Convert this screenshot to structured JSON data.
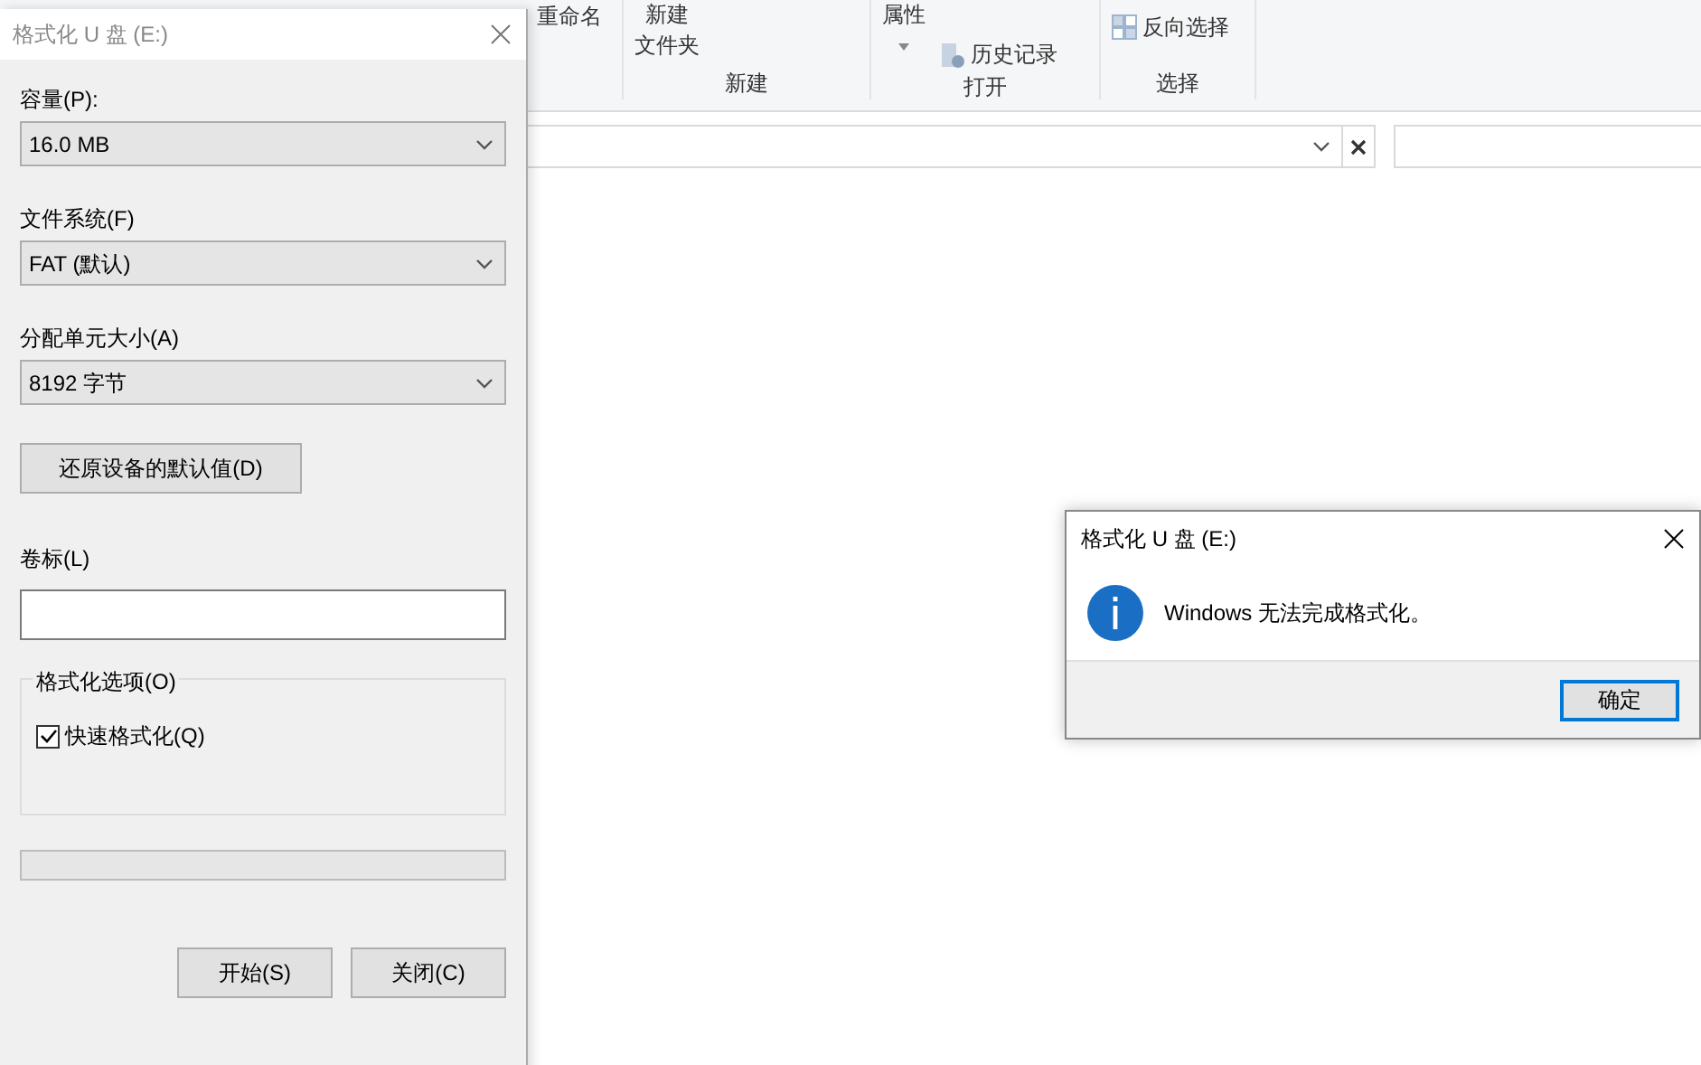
{
  "explorer": {
    "ribbon_groups": [
      {
        "items": [
          {
            "kind": "small",
            "label": "重命名"
          }
        ]
      },
      {
        "items": [
          {
            "kind": "large",
            "lines": [
              "新建",
              "文件夹"
            ]
          }
        ],
        "label": "新建"
      },
      {
        "items": [
          {
            "kind": "large",
            "lines": [
              "属性"
            ],
            "dropdown": true
          },
          {
            "kind": "small",
            "label": "历史记录"
          }
        ],
        "label": "打开"
      },
      {
        "items": [
          {
            "kind": "small",
            "label": "反向选择"
          }
        ],
        "label": "选择"
      }
    ]
  },
  "format_dialog": {
    "title": "格式化 U 盘 (E:)",
    "active": false,
    "fields": [
      {
        "kind": "select",
        "label": "容量(P):",
        "value": "16.0 MB"
      },
      {
        "kind": "select",
        "label": "文件系统(F)",
        "value": "FAT (默认)"
      },
      {
        "kind": "select",
        "label": "分配单元大小(A)",
        "value": "8192 字节"
      },
      {
        "kind": "button",
        "label": "还原设备的默认值(D)"
      },
      {
        "kind": "text",
        "label": "卷标(L)"
      }
    ],
    "options": {
      "title": "格式化选项(O)",
      "checkboxes": [
        {
          "label": "快速格式化(Q)",
          "checked": true
        }
      ]
    },
    "progress": {
      "level": 0
    },
    "buttons": [
      "开始(S)",
      "关闭(C)"
    ]
  },
  "message_box": {
    "title": "格式化 U 盘 (E:)",
    "active": true,
    "message": "Windows 无法完成格式化。",
    "buttons": [
      {
        "label": "确定",
        "default": true
      }
    ]
  }
}
